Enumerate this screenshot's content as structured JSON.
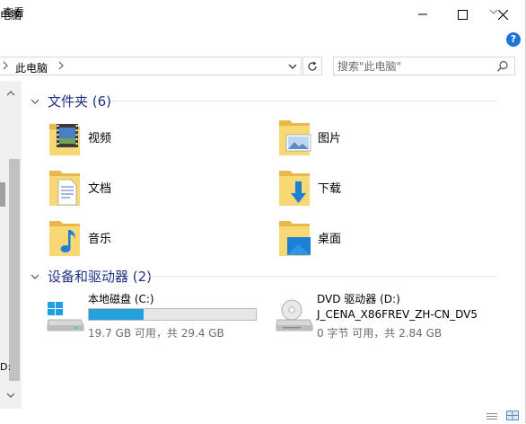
{
  "window": {
    "title": "电脑",
    "minimize_icon": "minimize-icon",
    "maximize_icon": "maximize-icon",
    "close_icon": "close-icon"
  },
  "ribbon": {
    "tab_view": "查看"
  },
  "address": {
    "path": "此电脑"
  },
  "search": {
    "placeholder": "搜索\"此电脑\""
  },
  "nav": {
    "label": "D:"
  },
  "folders": {
    "header": "文件夹 (6)",
    "items": [
      {
        "label": "视频",
        "icon": "videos-folder-icon"
      },
      {
        "label": "图片",
        "icon": "pictures-folder-icon"
      },
      {
        "label": "文档",
        "icon": "documents-folder-icon"
      },
      {
        "label": "下载",
        "icon": "downloads-folder-icon"
      },
      {
        "label": "音乐",
        "icon": "music-folder-icon"
      },
      {
        "label": "桌面",
        "icon": "desktop-folder-icon"
      }
    ]
  },
  "devices": {
    "header": "设备和驱动器 (2)",
    "drives": [
      {
        "name": "本地磁盘 (C:)",
        "info": "19.7 GB 可用，共 29.4 GB",
        "used_fraction": 0.33
      },
      {
        "name": "DVD 驱动器 (D:)",
        "name2": "J_CENA_X86FREV_ZH-CN_DV5",
        "info": "0 字节 可用，共 2.84 GB"
      }
    ]
  },
  "colors": {
    "accent_header": "#1e3287",
    "usage_bar": "#26a0da",
    "folder_yellow": "#f8d775",
    "help_blue": "#1e73d6"
  }
}
